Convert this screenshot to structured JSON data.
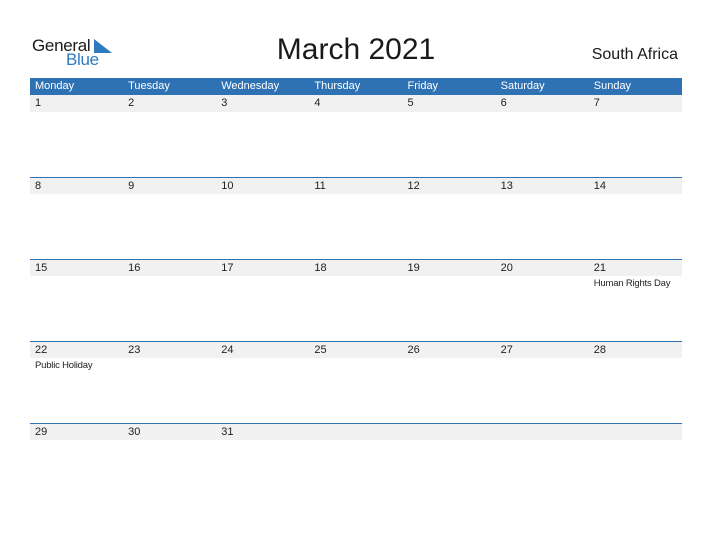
{
  "logo": {
    "part1": "General",
    "part2": "Blue"
  },
  "title": "March 2021",
  "country": "South Africa",
  "colors": {
    "header": "#2e72b3",
    "logo_blue": "#2e7bbf",
    "day_row": "#f1f1f1"
  },
  "weekdays": [
    "Monday",
    "Tuesday",
    "Wednesday",
    "Thursday",
    "Friday",
    "Saturday",
    "Sunday"
  ],
  "weeks": [
    {
      "days": [
        "1",
        "2",
        "3",
        "4",
        "5",
        "6",
        "7"
      ],
      "events": [
        "",
        "",
        "",
        "",
        "",
        "",
        ""
      ]
    },
    {
      "days": [
        "8",
        "9",
        "10",
        "11",
        "12",
        "13",
        "14"
      ],
      "events": [
        "",
        "",
        "",
        "",
        "",
        "",
        ""
      ]
    },
    {
      "days": [
        "15",
        "16",
        "17",
        "18",
        "19",
        "20",
        "21"
      ],
      "events": [
        "",
        "",
        "",
        "",
        "",
        "",
        "Human Rights Day"
      ]
    },
    {
      "days": [
        "22",
        "23",
        "24",
        "25",
        "26",
        "27",
        "28"
      ],
      "events": [
        "Public Holiday",
        "",
        "",
        "",
        "",
        "",
        ""
      ]
    },
    {
      "days": [
        "29",
        "30",
        "31",
        "",
        "",
        "",
        ""
      ],
      "events": [
        "",
        "",
        "",
        "",
        "",
        "",
        ""
      ]
    }
  ]
}
